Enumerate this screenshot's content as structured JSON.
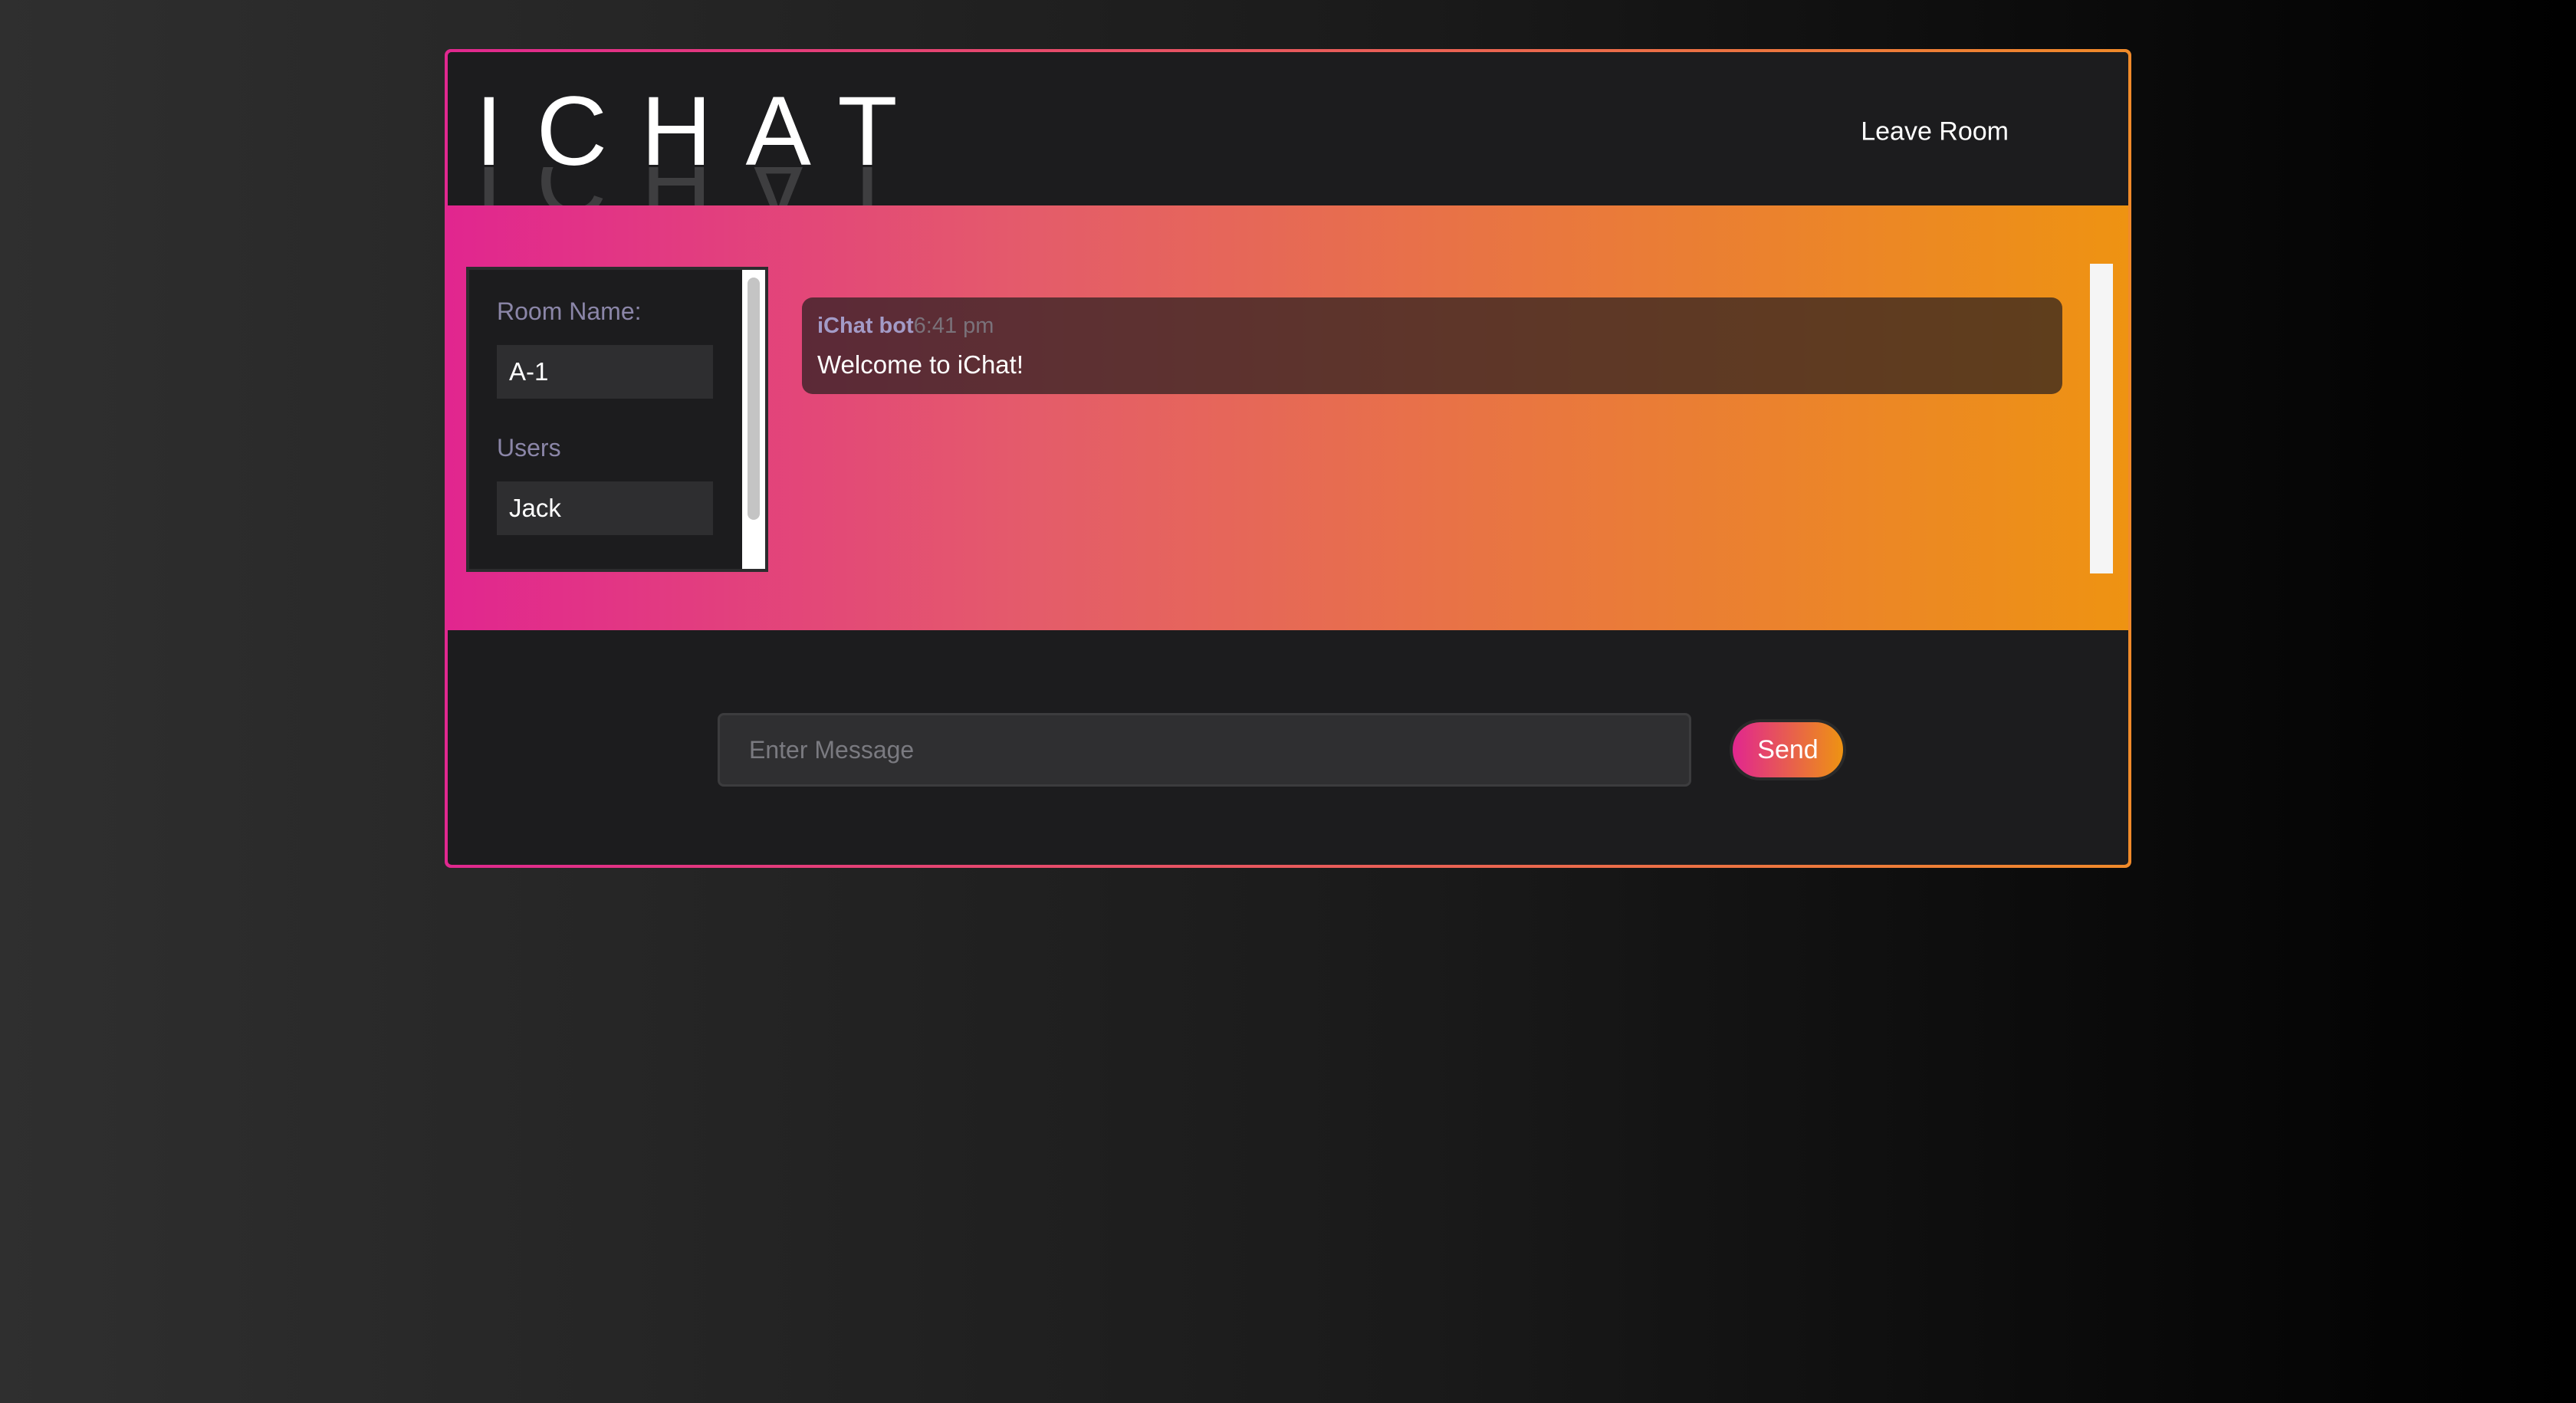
{
  "app": {
    "logo_text": "ICHAT",
    "leave_room_label": "Leave Room"
  },
  "sidebar": {
    "room_name_label": "Room Name:",
    "room_name_value": "A-1",
    "users_label": "Users",
    "users": [
      "Jack"
    ]
  },
  "messages": [
    {
      "author": "iChat bot",
      "time": "6:41 pm",
      "text": "Welcome to iChat!"
    }
  ],
  "composer": {
    "placeholder": "Enter Message",
    "send_label": "Send"
  },
  "colors": {
    "gradient_start": "#e1268f",
    "gradient_end": "#ee9312",
    "panel_bg": "#1c1c1e"
  }
}
